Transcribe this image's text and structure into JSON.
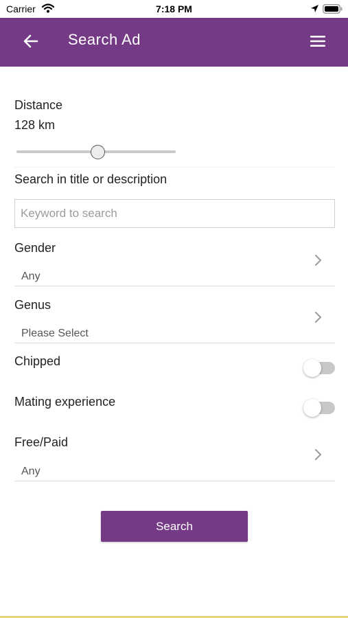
{
  "status_bar": {
    "carrier": "Carrier",
    "time": "7:18 PM",
    "icons": [
      "wifi-icon",
      "location-icon",
      "battery-icon"
    ]
  },
  "app_bar": {
    "title": "Search Ad",
    "back_icon": "arrow-left-icon",
    "menu_icon": "hamburger-menu-icon",
    "color": "#743a86"
  },
  "form": {
    "distance": {
      "label": "Distance",
      "value": "128 km",
      "slider_fraction": 0.51
    },
    "keyword": {
      "label": "Search in title or description",
      "value": "",
      "placeholder": "Keyword to search"
    },
    "gender": {
      "label": "Gender",
      "value": "Any"
    },
    "genus": {
      "label": "Genus",
      "value": "Please Select"
    },
    "chipped": {
      "label": "Chipped",
      "on": false
    },
    "mating_experience": {
      "label": "Mating experience",
      "on": false
    },
    "free_paid": {
      "label": "Free/Paid",
      "value": "Any"
    },
    "submit_label": "Search"
  },
  "colors": {
    "accent": "#743a86",
    "toggle_off": "#c8c8c8"
  }
}
